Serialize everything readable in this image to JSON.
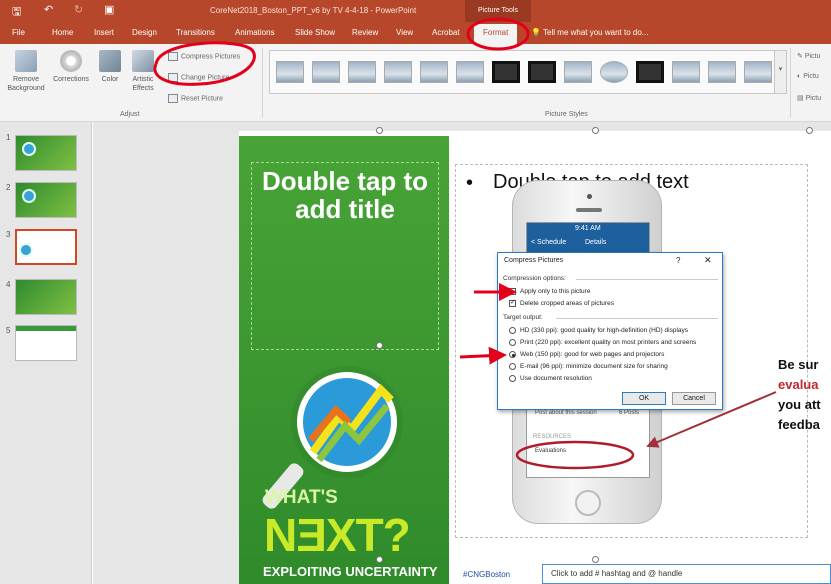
{
  "titlebar": {
    "doc_title": "CoreNet2018_Boston_PPT_v6 by TV 4-4-18 - PowerPoint",
    "context_tab": "Picture Tools",
    "save_icon": "save-icon",
    "undo_icon": "undo-icon",
    "redo_icon": "redo-icon",
    "present_icon": "present-icon"
  },
  "tabs": [
    "File",
    "Home",
    "Insert",
    "Design",
    "Transitions",
    "Animations",
    "Slide Show",
    "Review",
    "View",
    "Acrobat",
    "Format"
  ],
  "tell_me": "Tell me what you want to do...",
  "ribbon": {
    "remove_background": "Remove Background",
    "corrections": "Corrections",
    "color": "Color",
    "artistic_effects": "Artistic Effects",
    "compress_pictures": "Compress Pictures",
    "change_picture": "Change Picture",
    "reset_picture": "Reset Picture",
    "adjust_label": "Adjust",
    "picture_styles_label": "Picture Styles",
    "right_picture_border": "Pictu",
    "right_picture_effects": "Pictu",
    "right_picture_layout": "Pictu"
  },
  "thumbnails": [
    "1",
    "2",
    "3",
    "4",
    "5"
  ],
  "slide": {
    "title_placeholder": "Double tap to add title",
    "bullet_text": "Double tap to add text",
    "logo_whats": "WHAT'S",
    "logo_next": "NƎXT?",
    "logo_sub": "EXPLOITING UNCERTAINTY",
    "callout_line1": "Be sur",
    "callout_line2": "evalua",
    "callout_line3": "you att",
    "callout_line4": "feedba"
  },
  "phone": {
    "time": "9:41 AM",
    "back": "< Schedule",
    "details": "Details",
    "post_session": "Post about this session",
    "posts_count": "6 Posts",
    "resources": "RESOURCES",
    "evaluations": "Evaluations"
  },
  "dialog": {
    "title": "Compress Pictures",
    "help": "?",
    "close": "✕",
    "compression_options": "Compression options:",
    "apply_only": "Apply only to this picture",
    "delete_cropped": "Delete cropped areas of pictures",
    "target_output": "Target output:",
    "options": [
      "HD (330 ppi): good quality for high-definition (HD) displays",
      "Print (220 ppi): excellent quality on most printers and screens",
      "Web (150 ppi): good for web pages and projectors",
      "E-mail (96 ppi): minimize document size for sharing",
      "Use document resolution"
    ],
    "selected_option": 2,
    "ok": "OK",
    "cancel": "Cancel"
  },
  "notes": {
    "hashtag": "#CNGBoston",
    "placeholder": "Click to add # hashtag and @ handle"
  },
  "colors": {
    "accent": "#b7472a",
    "annotation_red": "#e2001a",
    "green": "#3b9630"
  }
}
